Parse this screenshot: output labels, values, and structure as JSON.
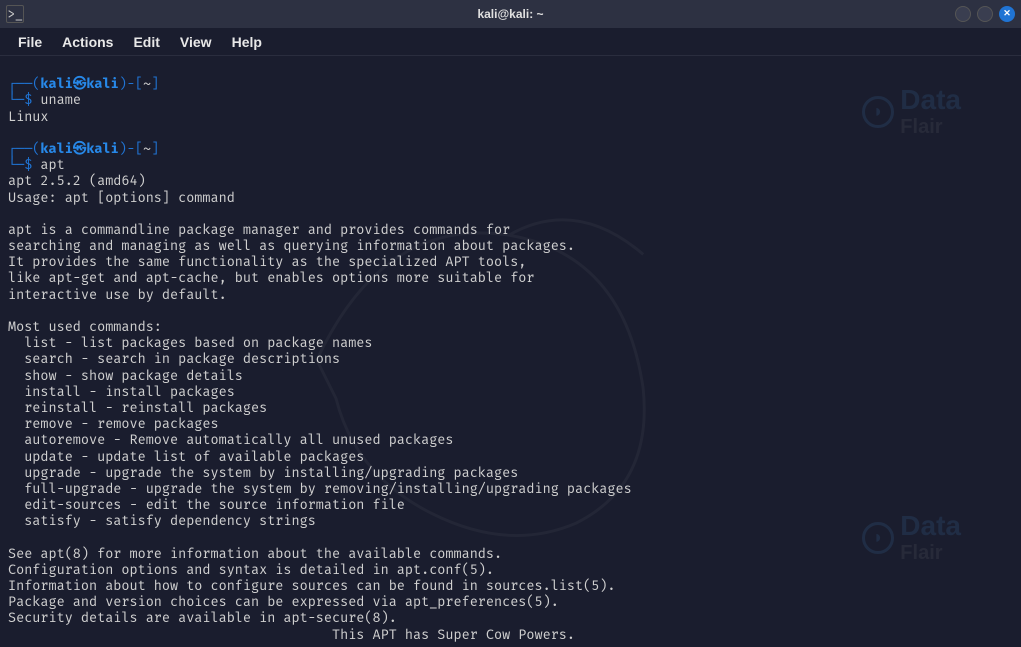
{
  "titlebar": {
    "title": "kali@kali: ~"
  },
  "menubar": {
    "file": "File",
    "actions": "Actions",
    "edit": "Edit",
    "view": "View",
    "help": "Help"
  },
  "prompt": {
    "open_paren": "┌──(",
    "user": "kali",
    "at": "㉿",
    "host": "kali",
    "close_paren": ")-[",
    "path": "~",
    "end_bracket": "]",
    "line2_prefix": "└─",
    "dollar": "$"
  },
  "commands": {
    "cmd1": "uname",
    "out1": "Linux",
    "cmd2": "apt",
    "apt_version": "apt 2.5.2 (amd64)",
    "apt_usage": "Usage: apt [options] command",
    "apt_desc1": "apt is a commandline package manager and provides commands for",
    "apt_desc2": "searching and managing as well as querying information about packages.",
    "apt_desc3": "It provides the same functionality as the specialized APT tools,",
    "apt_desc4": "like apt-get and apt-cache, but enables options more suitable for",
    "apt_desc5": "interactive use by default.",
    "apt_most_used": "Most used commands:",
    "apt_list": "  list - list packages based on package names",
    "apt_search": "  search - search in package descriptions",
    "apt_show": "  show - show package details",
    "apt_install": "  install - install packages",
    "apt_reinstall": "  reinstall - reinstall packages",
    "apt_remove": "  remove - remove packages",
    "apt_autoremove": "  autoremove - Remove automatically all unused packages",
    "apt_update": "  update - update list of available packages",
    "apt_upgrade": "  upgrade - upgrade the system by installing/upgrading packages",
    "apt_full_upgrade": "  full-upgrade - upgrade the system by removing/installing/upgrading packages",
    "apt_edit_sources": "  edit-sources - edit the source information file",
    "apt_satisfy": "  satisfy - satisfy dependency strings",
    "apt_footer1": "See apt(8) for more information about the available commands.",
    "apt_footer2": "Configuration options and syntax is detailed in apt.conf(5).",
    "apt_footer3": "Information about how to configure sources can be found in sources.list(5).",
    "apt_footer4": "Package and version choices can be expressed via apt_preferences(5).",
    "apt_footer5": "Security details are available in apt-secure(8).",
    "apt_cow": "                                        This APT has Super Cow Powers."
  },
  "watermark": {
    "text1": "Data",
    "text2": "Flair"
  }
}
